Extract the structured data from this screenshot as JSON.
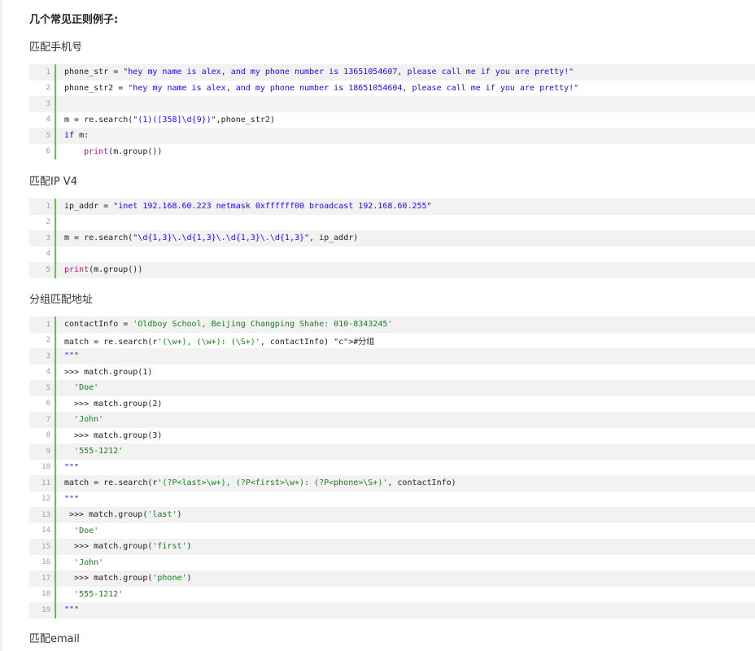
{
  "page": {
    "heading": "几个常见正则例子:"
  },
  "sections": [
    {
      "title": "匹配手机号",
      "lines": [
        {
          "n": "1",
          "code": "phone_str = \"hey my name is alex, and my phone number is 13651054607, please call me if you are pretty!\""
        },
        {
          "n": "2",
          "code": "phone_str2 = \"hey my name is alex, and my phone number is 18651054604, please call me if you are pretty!\""
        },
        {
          "n": "3",
          "code": ""
        },
        {
          "n": "4",
          "code": "m = re.search(\"(1)([358]\\d{9})\",phone_str2)"
        },
        {
          "n": "5",
          "code": "if m:"
        },
        {
          "n": "6",
          "code": "    print(m.group())"
        }
      ]
    },
    {
      "title": "匹配IP V4",
      "lines": [
        {
          "n": "1",
          "code": "ip_addr = \"inet 192.168.60.223 netmask 0xffffff00 broadcast 192.168.60.255\""
        },
        {
          "n": "2",
          "code": ""
        },
        {
          "n": "3",
          "code": "m = re.search(\"\\d{1,3}\\.\\d{1,3}\\.\\d{1,3}\\.\\d{1,3}\", ip_addr)"
        },
        {
          "n": "4",
          "code": ""
        },
        {
          "n": "5",
          "code": "print(m.group())"
        }
      ]
    },
    {
      "title": "分组匹配地址",
      "lines": [
        {
          "n": "1",
          "code": "contactInfo = 'Oldboy School, Beijing Changping Shahe: 010-8343245'"
        },
        {
          "n": "2",
          "code": "match = re.search(r'(\\w+), (\\w+): (\\S+)', contactInfo) #分组"
        },
        {
          "n": "3",
          "code": "\"\"\""
        },
        {
          "n": "4",
          "code": ">>> match.group(1)"
        },
        {
          "n": "5",
          "code": "  'Doe'"
        },
        {
          "n": "6",
          "code": "  >>> match.group(2)"
        },
        {
          "n": "7",
          "code": "  'John'"
        },
        {
          "n": "8",
          "code": "  >>> match.group(3)"
        },
        {
          "n": "9",
          "code": "  '555-1212'"
        },
        {
          "n": "10",
          "code": "\"\"\""
        },
        {
          "n": "11",
          "code": "match = re.search(r'(?P<last>\\w+), (?P<first>\\w+): (?P<phone>\\S+)', contactInfo)"
        },
        {
          "n": "12",
          "code": "\"\"\""
        },
        {
          "n": "13",
          "code": " >>> match.group('last')"
        },
        {
          "n": "14",
          "code": "  'Doe'"
        },
        {
          "n": "15",
          "code": "  >>> match.group('first')"
        },
        {
          "n": "16",
          "code": "  'John'"
        },
        {
          "n": "17",
          "code": "  >>> match.group('phone')"
        },
        {
          "n": "18",
          "code": "  '555-1212'"
        },
        {
          "n": "19",
          "code": "\"\"\""
        }
      ]
    },
    {
      "title": "匹配email",
      "lines": []
    }
  ]
}
